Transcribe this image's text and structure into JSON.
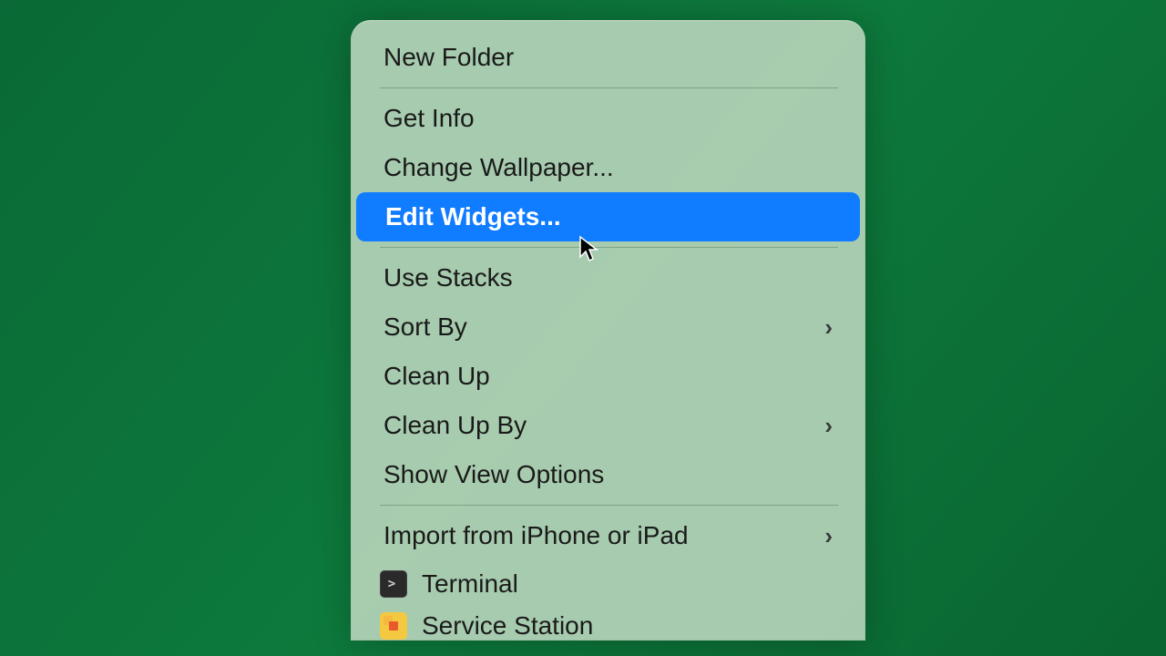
{
  "menu": {
    "items": [
      {
        "label": "New Folder",
        "submenu": false
      },
      {
        "divider": true
      },
      {
        "label": "Get Info",
        "submenu": false
      },
      {
        "label": "Change Wallpaper...",
        "submenu": false
      },
      {
        "label": "Edit Widgets...",
        "submenu": false,
        "selected": true
      },
      {
        "divider": true
      },
      {
        "label": "Use Stacks",
        "submenu": false
      },
      {
        "label": "Sort By",
        "submenu": true
      },
      {
        "label": "Clean Up",
        "submenu": false
      },
      {
        "label": "Clean Up By",
        "submenu": true
      },
      {
        "label": "Show View Options",
        "submenu": false
      },
      {
        "divider": true
      },
      {
        "label": "Import from iPhone or iPad",
        "submenu": true
      },
      {
        "label": "Terminal",
        "icon": "terminal"
      },
      {
        "label": "Service Station",
        "icon": "station",
        "truncated": true
      }
    ]
  }
}
